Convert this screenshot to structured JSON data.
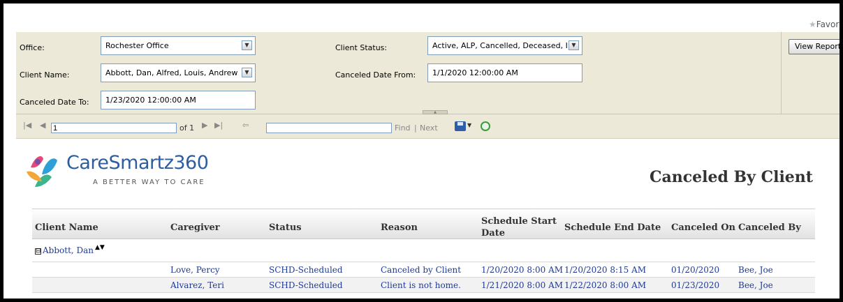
{
  "favorites_label": "Favor",
  "params": {
    "office_label": "Office:",
    "office_value": "Rochester Office",
    "client_name_label": "Client Name:",
    "client_name_value": "Abbott, Dan, Alfred, Louis, Andrew",
    "canceled_to_label": "Canceled Date To:",
    "canceled_to_value": "1/23/2020 12:00:00 AM",
    "client_status_label": "Client Status:",
    "client_status_value": "Active, ALP, Cancelled, Deceased, I",
    "canceled_from_label": "Canceled Date From:",
    "canceled_from_value": "1/1/2020 12:00:00 AM",
    "view_report_label": "View Report"
  },
  "toolbar": {
    "page_value": "1",
    "page_of": "of 1",
    "find_value": "",
    "find_label": "Find",
    "separator": "|",
    "next_label": "Next"
  },
  "report": {
    "brand_name": "CareSmartz360",
    "tagline": "A BETTER WAY TO CARE",
    "title": "Canceled By Client",
    "columns": [
      "Client Name",
      "Caregiver",
      "Status",
      "Reason",
      "Schedule Start Date",
      "Schedule End Date",
      "Canceled On",
      "Canceled By"
    ],
    "group": {
      "toggle": "⊟",
      "name": "Abbott, Dan",
      "sort_icon": "▲▼"
    },
    "rows": [
      {
        "caregiver": "Love, Percy",
        "status": "SCHD-Scheduled",
        "reason": "Canceled by Client",
        "start": "1/20/2020 8:00 AM",
        "end": "1/20/2020 8:15 AM",
        "canceled_on": "01/20/2020",
        "canceled_by": "Bee, Joe"
      },
      {
        "caregiver": "Alvarez, Teri",
        "status": "SCHD-Scheduled",
        "reason": "Client is not home.",
        "start": "1/21/2020 8:00 AM",
        "end": "1/22/2020 8:00 AM",
        "canceled_on": "01/23/2020",
        "canceled_by": "Bee, Joe"
      }
    ]
  },
  "colors": {
    "panel": "#ece9d8",
    "brand_blue": "#2d5d9f",
    "link_blue": "#1f3a93"
  }
}
